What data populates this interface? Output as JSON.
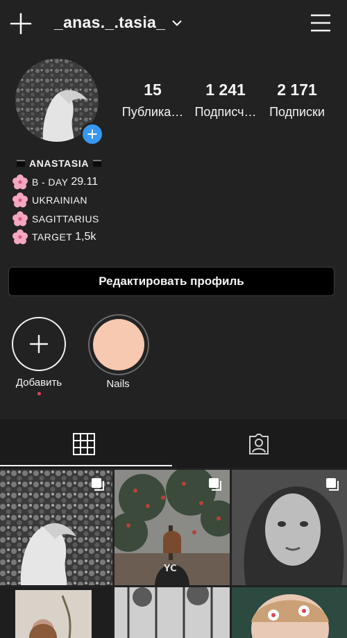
{
  "header": {
    "username": "_anas._.tasia_"
  },
  "profile": {
    "stats": [
      {
        "value": "15",
        "label": "Публика…"
      },
      {
        "value": "1 241",
        "label": "Подписч…"
      },
      {
        "value": "2 171",
        "label": "Подписки"
      }
    ],
    "bio": {
      "name": "ANASTASIA",
      "lines": [
        {
          "prefix": "B - DAY",
          "value": "29.11"
        },
        {
          "prefix": "UKRAINIAN",
          "value": ""
        },
        {
          "prefix": "SAGITTARIUS",
          "value": ""
        },
        {
          "prefix": "TARGET",
          "value": "1,5k"
        }
      ]
    },
    "edit_button_label": "Редактировать профиль"
  },
  "highlights": [
    {
      "label": "Добавить"
    },
    {
      "label": "Nails",
      "color": "#f7c9b0"
    }
  ],
  "tabs": [
    "grid",
    "tagged"
  ],
  "colors": {
    "accent": "#3897f0",
    "background": "#222222",
    "highlight_dot": "#e0425a"
  }
}
